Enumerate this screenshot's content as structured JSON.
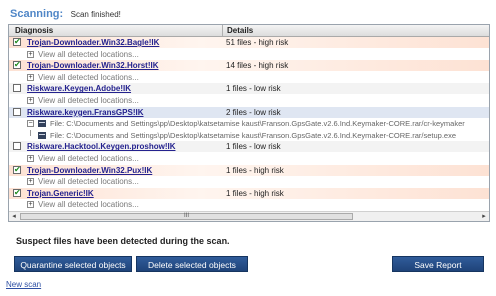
{
  "status": {
    "label": "Scanning:",
    "value": "Scan finished!"
  },
  "grid": {
    "columns": [
      "Diagnosis",
      "Details"
    ],
    "rows": [
      {
        "kind": "threat",
        "style": "high",
        "checked": true,
        "name": "Trojan-Downloader.Win32.Bagle!IK",
        "details": "51 files - high risk"
      },
      {
        "kind": "sub",
        "text": "View all detected locations..."
      },
      {
        "kind": "threat",
        "style": "high",
        "checked": true,
        "name": "Trojan-Downloader.Win32.Horst!IK",
        "details": "14 files - high risk"
      },
      {
        "kind": "sub",
        "text": "View all detected locations..."
      },
      {
        "kind": "threat",
        "style": "low",
        "checked": false,
        "name": "Riskware.Keygen.Adobe!IK",
        "details": "1 files - low risk"
      },
      {
        "kind": "sub",
        "text": "View all detected locations..."
      },
      {
        "kind": "threat",
        "style": "bluey",
        "checked": false,
        "name": "Riskware.keygen.FransGPS!IK",
        "details": "2 files - low risk"
      },
      {
        "kind": "file",
        "minus": true,
        "text": "File: C:\\Documents and Settings\\pp\\Desktop\\katsetamise kaust\\Franson.GpsGate.v2.6.Ind.Keymaker-CORE.rar/cr-keymaker"
      },
      {
        "kind": "file",
        "minus": false,
        "text": "File: C:\\Documents and Settings\\pp\\Desktop\\katsetamise kaust\\Franson.GpsGate.v2.6.Ind.Keymaker-CORE.rar/setup.exe"
      },
      {
        "kind": "threat",
        "style": "low",
        "checked": false,
        "name": "Riskware.Hacktool.Keygen.proshow!IK",
        "details": "1 files - low risk"
      },
      {
        "kind": "sub",
        "text": "View all detected locations..."
      },
      {
        "kind": "threat",
        "style": "high",
        "checked": true,
        "name": "Trojan-Downloader.Win32.Pux!IK",
        "details": "1 files - high risk"
      },
      {
        "kind": "sub",
        "text": "View all detected locations..."
      },
      {
        "kind": "threat",
        "style": "high",
        "checked": true,
        "name": "Trojan.Generic!IK",
        "details": "1 files - high risk"
      },
      {
        "kind": "sub",
        "text": "View all detected locations..."
      }
    ],
    "scroll_thumb_grip": "III"
  },
  "message": "Suspect files have been detected during the scan.",
  "buttons": {
    "quarantine": "Quarantine selected objects",
    "delete": "Delete selected objects",
    "save": "Save Report"
  },
  "new_scan": "New scan",
  "icons": {
    "checkmark": "✔",
    "expand": "+",
    "collapse": "−",
    "left": "◂",
    "right": "▸"
  }
}
